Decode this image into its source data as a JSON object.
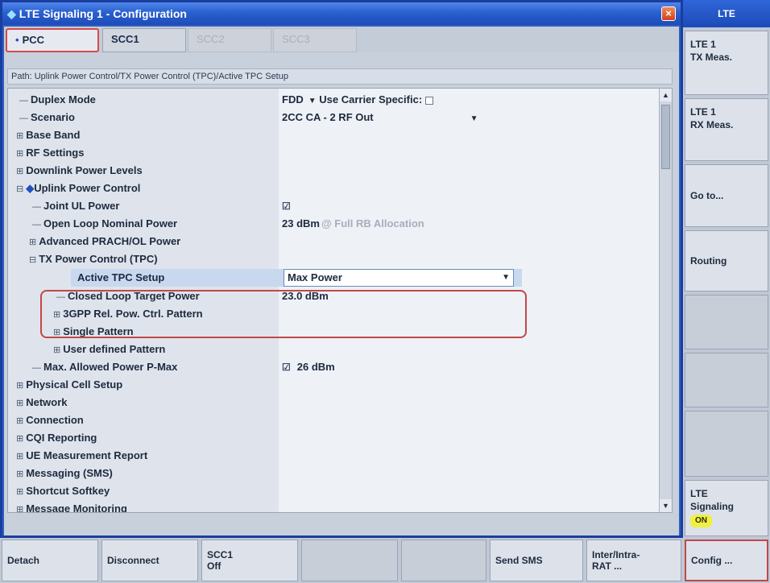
{
  "window": {
    "title": "LTE Signaling 1 - Configuration",
    "close": "×"
  },
  "tabs": [
    {
      "label": "PCC",
      "state": "active"
    },
    {
      "label": "SCC1",
      "state": "normal"
    },
    {
      "label": "SCC2",
      "state": "disabled"
    },
    {
      "label": "SCC3",
      "state": "disabled"
    }
  ],
  "path": "Path: Uplink Power Control/TX Power Control (TPC)/Active TPC Setup",
  "tree": [
    {
      "label": "Duplex Mode",
      "value": "FDD",
      "extra": "Use Carrier Specific:"
    },
    {
      "label": "Scenario",
      "value": "2CC CA - 2 RF Out"
    },
    {
      "label": "Base Band"
    },
    {
      "label": "RF Settings"
    },
    {
      "label": "Downlink Power Levels"
    },
    {
      "label": "Uplink Power Control"
    },
    {
      "label": "Joint UL Power",
      "value": "☑"
    },
    {
      "label": "Open Loop Nominal Power",
      "value": "23 dBm",
      "extra": "@ Full RB Allocation"
    },
    {
      "label": "Advanced PRACH/OL Power"
    },
    {
      "label": "TX Power Control (TPC)"
    },
    {
      "label": "Active TPC Setup",
      "value": "Max Power"
    },
    {
      "label": "Closed Loop Target Power",
      "value": "23.0 dBm"
    },
    {
      "label": "3GPP Rel. Pow. Ctrl. Pattern"
    },
    {
      "label": "Single Pattern"
    },
    {
      "label": "User defined Pattern"
    },
    {
      "label": "Max. Allowed Power P-Max",
      "value": "26 dBm"
    },
    {
      "label": "Physical Cell Setup"
    },
    {
      "label": "Network"
    },
    {
      "label": "Connection"
    },
    {
      "label": "CQI Reporting"
    },
    {
      "label": "UE Measurement Report"
    },
    {
      "label": "Messaging (SMS)"
    },
    {
      "label": "Shortcut Softkey"
    },
    {
      "label": "Message Monitoring"
    }
  ],
  "softkeys": {
    "header": "LTE",
    "items": [
      "LTE 1\nTX Meas.",
      "LTE 1\nRX Meas.",
      "Go to...",
      "Routing",
      "",
      "",
      "",
      "LTE\nSignaling"
    ],
    "signaling_badge": "ON"
  },
  "hotkeys": [
    "Detach",
    "Disconnect",
    "SCC1\nOff",
    "",
    "",
    "Send SMS",
    "Inter/Intra-\nRAT ...",
    "Config ..."
  ],
  "icons": {
    "expand": "⊞",
    "collapse": "⊟",
    "arrow": "▼",
    "scroll_up": "▲",
    "scroll_down": "▼",
    "diamond": "◆"
  },
  "colors": {
    "title_bar": "#2a5fd0",
    "highlight": "#c04848",
    "badge": "#f0f040"
  }
}
